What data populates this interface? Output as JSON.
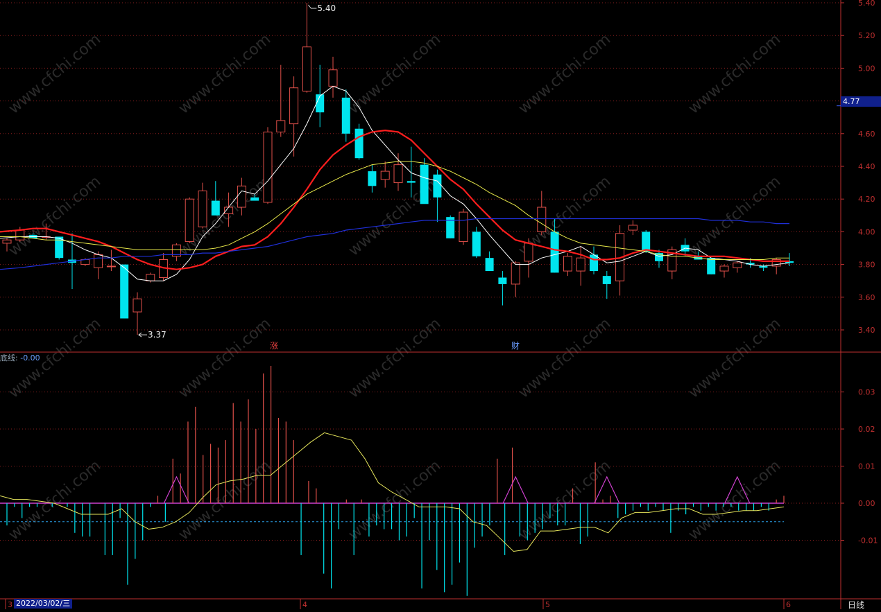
{
  "colors": {
    "up": "#e2504a",
    "down": "#00e5ee",
    "ma5": "#ffffff",
    "ma10": "#ff1e1e",
    "ma20": "#e8e84a",
    "ma60": "#1f2fd8",
    "grid": "#8a1e1e",
    "axis": "#c03030",
    "ind_line": "#e6e65c",
    "ind_ref": "#2aa0e8",
    "ind_zero": "#d040d0"
  },
  "watermark": "www.cfchi.com",
  "price_axis": {
    "ticks": [
      "5.40",
      "5.20",
      "5.00",
      "4.80",
      "4.60",
      "4.40",
      "4.20",
      "4.00",
      "3.80",
      "3.60",
      "3.40"
    ]
  },
  "current_price": "4.77",
  "annotations": {
    "high": "5.40",
    "low": "3.37",
    "marker_zhang": "涨",
    "marker_cai": "财"
  },
  "indicator": {
    "label_name": "底线:",
    "label_value": "-0.00",
    "ticks": [
      "0.03",
      "0.02",
      "0.01",
      "0.00",
      "-0.01"
    ]
  },
  "time_axis": {
    "date_box": "2022/03/02/三",
    "months": [
      "3",
      "4",
      "5",
      "6"
    ],
    "period_tab": "日线"
  },
  "chart_data": [
    {
      "type": "candlestick",
      "ylim": [
        3.3,
        5.4
      ],
      "grid": true,
      "candles": [
        {
          "o": 3.93,
          "h": 3.96,
          "l": 3.88,
          "c": 3.95
        },
        {
          "o": 3.95,
          "h": 4.03,
          "l": 3.94,
          "c": 4.01
        },
        {
          "o": 3.98,
          "h": 3.99,
          "l": 3.96,
          "c": 3.96
        },
        {
          "o": 3.97,
          "h": 4.05,
          "l": 3.95,
          "c": 3.97
        },
        {
          "o": 3.97,
          "h": 3.97,
          "l": 3.83,
          "c": 3.84
        },
        {
          "o": 3.83,
          "h": 3.99,
          "l": 3.65,
          "c": 3.81
        },
        {
          "o": 3.8,
          "h": 3.84,
          "l": 3.79,
          "c": 3.83
        },
        {
          "o": 3.78,
          "h": 3.88,
          "l": 3.71,
          "c": 3.86
        },
        {
          "o": 3.79,
          "h": 3.89,
          "l": 3.76,
          "c": 3.79
        },
        {
          "o": 3.8,
          "h": 3.8,
          "l": 3.47,
          "c": 3.47
        },
        {
          "o": 3.51,
          "h": 3.63,
          "l": 3.37,
          "c": 3.59
        },
        {
          "o": 3.7,
          "h": 3.75,
          "l": 3.69,
          "c": 3.74
        },
        {
          "o": 3.72,
          "h": 3.87,
          "l": 3.7,
          "c": 3.83
        },
        {
          "o": 3.85,
          "h": 3.93,
          "l": 3.82,
          "c": 3.92
        },
        {
          "o": 3.94,
          "h": 4.21,
          "l": 3.93,
          "c": 4.2
        },
        {
          "o": 4.03,
          "h": 4.3,
          "l": 4.02,
          "c": 4.25
        },
        {
          "o": 4.19,
          "h": 4.31,
          "l": 4.11,
          "c": 4.1
        },
        {
          "o": 4.11,
          "h": 4.24,
          "l": 4.03,
          "c": 4.15
        },
        {
          "o": 4.15,
          "h": 4.33,
          "l": 4.1,
          "c": 4.28
        },
        {
          "o": 4.21,
          "h": 4.23,
          "l": 4.2,
          "c": 4.19
        },
        {
          "o": 4.18,
          "h": 4.64,
          "l": 4.17,
          "c": 4.61
        },
        {
          "o": 4.61,
          "h": 5.02,
          "l": 4.58,
          "c": 4.68
        },
        {
          "o": 4.66,
          "h": 4.95,
          "l": 4.46,
          "c": 4.88
        },
        {
          "o": 4.86,
          "h": 5.4,
          "l": 4.85,
          "c": 5.13
        },
        {
          "o": 4.84,
          "h": 5.02,
          "l": 4.64,
          "c": 4.73
        },
        {
          "o": 4.89,
          "h": 5.07,
          "l": 4.82,
          "c": 4.99
        },
        {
          "o": 4.82,
          "h": 4.87,
          "l": 4.55,
          "c": 4.6
        },
        {
          "o": 4.63,
          "h": 4.66,
          "l": 4.44,
          "c": 4.45
        },
        {
          "o": 4.37,
          "h": 4.41,
          "l": 4.24,
          "c": 4.28
        },
        {
          "o": 4.32,
          "h": 4.43,
          "l": 4.27,
          "c": 4.37
        },
        {
          "o": 4.3,
          "h": 4.48,
          "l": 4.25,
          "c": 4.41
        },
        {
          "o": 4.31,
          "h": 4.52,
          "l": 4.21,
          "c": 4.3
        },
        {
          "o": 4.41,
          "h": 4.45,
          "l": 4.21,
          "c": 4.17
        },
        {
          "o": 4.35,
          "h": 4.38,
          "l": 4.06,
          "c": 4.21
        },
        {
          "o": 4.09,
          "h": 4.1,
          "l": 3.96,
          "c": 3.96
        },
        {
          "o": 3.94,
          "h": 4.14,
          "l": 3.92,
          "c": 4.12
        },
        {
          "o": 4.0,
          "h": 4.03,
          "l": 3.84,
          "c": 3.85
        },
        {
          "o": 3.84,
          "h": 3.88,
          "l": 3.76,
          "c": 3.76
        },
        {
          "o": 3.72,
          "h": 3.76,
          "l": 3.55,
          "c": 3.68
        },
        {
          "o": 3.68,
          "h": 3.82,
          "l": 3.6,
          "c": 3.81
        },
        {
          "o": 3.82,
          "h": 3.96,
          "l": 3.72,
          "c": 3.93
        },
        {
          "o": 4.0,
          "h": 4.25,
          "l": 3.98,
          "c": 4.15
        },
        {
          "o": 4.0,
          "h": 4.08,
          "l": 3.75,
          "c": 3.75
        },
        {
          "o": 3.76,
          "h": 3.87,
          "l": 3.73,
          "c": 3.85
        },
        {
          "o": 3.76,
          "h": 3.91,
          "l": 3.67,
          "c": 3.84
        },
        {
          "o": 3.86,
          "h": 3.91,
          "l": 3.74,
          "c": 3.76
        },
        {
          "o": 3.73,
          "h": 3.76,
          "l": 3.59,
          "c": 3.68
        },
        {
          "o": 3.7,
          "h": 4.04,
          "l": 3.61,
          "c": 3.99
        },
        {
          "o": 4.01,
          "h": 4.07,
          "l": 3.98,
          "c": 4.04
        },
        {
          "o": 4.0,
          "h": 4.01,
          "l": 3.87,
          "c": 3.88
        },
        {
          "o": 3.87,
          "h": 3.89,
          "l": 3.78,
          "c": 3.82
        },
        {
          "o": 3.76,
          "h": 3.91,
          "l": 3.71,
          "c": 3.89
        },
        {
          "o": 3.92,
          "h": 3.96,
          "l": 3.85,
          "c": 3.88
        },
        {
          "o": 3.85,
          "h": 3.88,
          "l": 3.83,
          "c": 3.83
        },
        {
          "o": 3.84,
          "h": 3.84,
          "l": 3.74,
          "c": 3.74
        },
        {
          "o": 3.76,
          "h": 3.8,
          "l": 3.72,
          "c": 3.79
        },
        {
          "o": 3.78,
          "h": 3.82,
          "l": 3.75,
          "c": 3.81
        },
        {
          "o": 3.81,
          "h": 3.84,
          "l": 3.78,
          "c": 3.8
        },
        {
          "o": 3.79,
          "h": 3.8,
          "l": 3.76,
          "c": 3.78
        },
        {
          "o": 3.79,
          "h": 3.84,
          "l": 3.74,
          "c": 3.83
        },
        {
          "o": 3.82,
          "h": 3.87,
          "l": 3.79,
          "c": 3.81
        }
      ],
      "ma_lines": [
        {
          "values": [
            3.96,
            3.97,
            3.97,
            3.97,
            3.96,
            3.93,
            3.89,
            3.86,
            3.84,
            3.78,
            3.71,
            3.7,
            3.7,
            3.74,
            3.83,
            3.97,
            4.05,
            4.15,
            4.25,
            4.23,
            4.31,
            4.41,
            4.51,
            4.66,
            4.83,
            4.89,
            4.86,
            4.76,
            4.62,
            4.53,
            4.44,
            4.36,
            4.33,
            4.31,
            4.22,
            4.17,
            4.08,
            3.98,
            3.89,
            3.8,
            3.8,
            3.84,
            3.86,
            3.88,
            3.91,
            3.86,
            3.81,
            3.82,
            3.85,
            3.88,
            3.85,
            3.86,
            3.9,
            3.89,
            3.84,
            3.83,
            3.82,
            3.8,
            3.79,
            3.8,
            3.81
          ]
        },
        {
          "values": [
            4.0,
            4.01,
            4.02,
            4.02,
            4.0,
            3.98,
            3.96,
            3.94,
            3.91,
            3.87,
            3.83,
            3.8,
            3.78,
            3.77,
            3.78,
            3.8,
            3.85,
            3.88,
            3.91,
            3.92,
            3.97,
            4.05,
            4.15,
            4.26,
            4.38,
            4.47,
            4.53,
            4.58,
            4.61,
            4.62,
            4.61,
            4.56,
            4.48,
            4.4,
            4.32,
            4.26,
            4.17,
            4.09,
            4.01,
            3.95,
            3.93,
            3.91,
            3.89,
            3.88,
            3.86,
            3.83,
            3.83,
            3.84,
            3.87,
            3.89,
            3.88,
            3.87,
            3.86,
            3.85,
            3.85,
            3.85,
            3.84,
            3.83,
            3.82,
            3.82,
            3.82
          ]
        },
        {
          "values": [
            3.97,
            3.97,
            3.96,
            3.95,
            3.95,
            3.94,
            3.93,
            3.92,
            3.91,
            3.9,
            3.89,
            3.89,
            3.89,
            3.89,
            3.89,
            3.89,
            3.9,
            3.92,
            3.96,
            4.0,
            4.05,
            4.11,
            4.17,
            4.23,
            4.27,
            4.31,
            4.35,
            4.38,
            4.41,
            4.42,
            4.43,
            4.43,
            4.42,
            4.4,
            4.37,
            4.33,
            4.29,
            4.24,
            4.2,
            4.16,
            4.1,
            4.05,
            4.0,
            3.96,
            3.93,
            3.92,
            3.91,
            3.9,
            3.89,
            3.88,
            3.86,
            3.85,
            3.85,
            3.84,
            3.83,
            3.83,
            3.83,
            3.83,
            3.83,
            3.84,
            3.84
          ]
        },
        {
          "values": [
            3.77,
            3.78,
            3.79,
            3.8,
            3.81,
            3.82,
            3.83,
            3.84,
            3.84,
            3.85,
            3.85,
            3.85,
            3.86,
            3.86,
            3.86,
            3.87,
            3.87,
            3.88,
            3.89,
            3.9,
            3.91,
            3.93,
            3.95,
            3.97,
            3.98,
            3.99,
            4.01,
            4.02,
            4.03,
            4.04,
            4.05,
            4.06,
            4.07,
            4.07,
            4.07,
            4.07,
            4.08,
            4.08,
            4.08,
            4.08,
            4.08,
            4.08,
            4.08,
            4.08,
            4.08,
            4.08,
            4.08,
            4.08,
            4.08,
            4.08,
            4.08,
            4.08,
            4.08,
            4.08,
            4.07,
            4.07,
            4.07,
            4.06,
            4.06,
            4.05,
            4.05
          ]
        }
      ]
    },
    {
      "type": "bar",
      "ylim": [
        -0.0225,
        0.0365
      ],
      "grid": true,
      "values": [
        -0.006,
        -0.001,
        -0.004,
        -0.001,
        -0.001,
        0,
        -0.001,
        0,
        -0.001,
        -0.008,
        -0.009,
        -0.009,
        0,
        -0.014,
        -0.014,
        -0.004,
        -0.022,
        -0.015,
        -0.01,
        -0.001,
        0.002,
        -0.005,
        0.012,
        0.008,
        0.022,
        0.026,
        0.013,
        0.016,
        0.015,
        0.017,
        0.027,
        0.022,
        0.028,
        0.02,
        0.035,
        0.037,
        0.023,
        0.022,
        0.017,
        -0.014,
        0.006,
        0.004,
        -0.019,
        -0.023,
        -0.007,
        0.001,
        -0.014,
        0.001,
        -0.009,
        -0.006,
        -0.007,
        -0.007,
        -0.01,
        -0.009,
        -0.004,
        -0.023,
        -0.01,
        -0.018,
        -0.024,
        -0.022,
        -0.016,
        -0.025,
        -0.012,
        -0.009,
        -0.006,
        0.012,
        -0.014,
        0.015,
        -0.009,
        -0.01,
        -0.008,
        -0.007,
        -0.004,
        -0.006,
        -0.006,
        0.004,
        -0.011,
        -0.009,
        0.011,
        0.001,
        0.002,
        -0.004,
        -0.003,
        -0.002,
        -0.001,
        -0.002,
        -0.001,
        -0.002,
        -0.008,
        -0.002,
        -0.003,
        -0.001,
        -0.002,
        -0.001,
        -0.002,
        -0.001,
        -0.001,
        -0.002,
        -0.002,
        -0.002,
        -0.001,
        -0.002,
        0.001,
        0.002
      ],
      "line": [
        0.002,
        0.001,
        0.001,
        0.0005,
        0,
        -0.0015,
        -0.003,
        -0.003,
        -0.003,
        -0.0015,
        -0.005,
        -0.007,
        -0.0065,
        -0.005,
        -0.0025,
        0.0015,
        0.005,
        0.006,
        0.0065,
        0.0075,
        0.0075,
        0.0105,
        0.0135,
        0.0165,
        0.019,
        0.018,
        0.017,
        0.012,
        0.0055,
        0.003,
        0.001,
        -0.001,
        -0.001,
        -0.001,
        -0.0015,
        -0.005,
        -0.006,
        -0.0095,
        -0.013,
        -0.0125,
        -0.0075,
        -0.0075,
        -0.007,
        -0.0065,
        -0.0065,
        -0.008,
        -0.004,
        -0.0025,
        -0.0025,
        -0.002,
        -0.0015,
        -0.0015,
        -0.003,
        -0.003,
        -0.0025,
        -0.002,
        -0.002,
        -0.0015,
        -0.001
      ],
      "zero_triangles": [
        13,
        39,
        46,
        56
      ],
      "reference": -0.005
    }
  ]
}
